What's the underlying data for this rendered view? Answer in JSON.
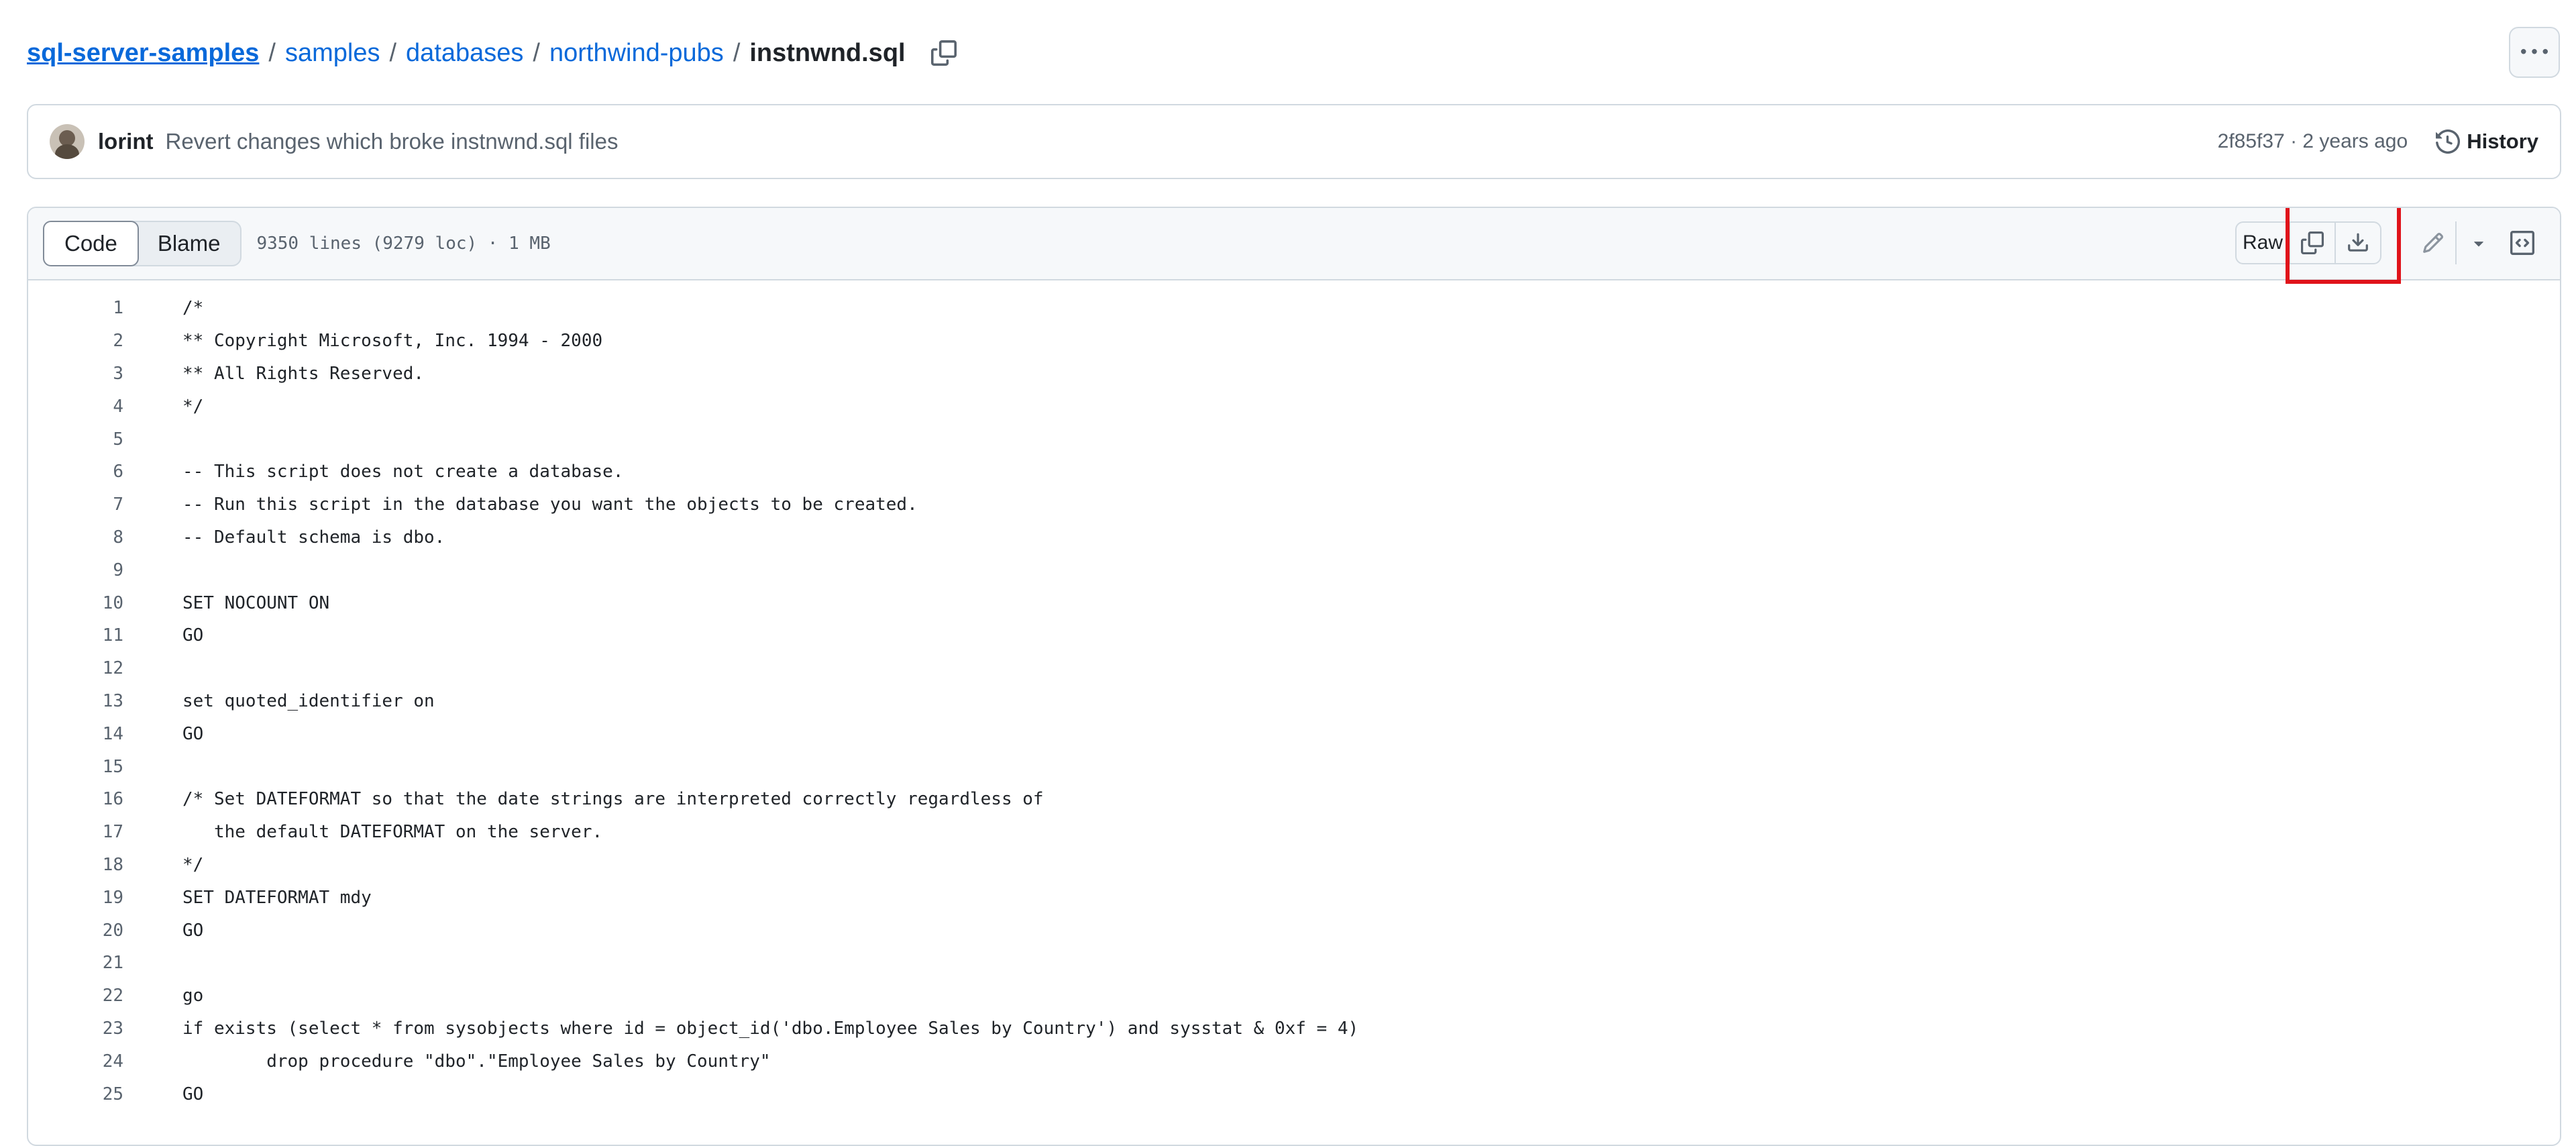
{
  "breadcrumb": {
    "repo": "sql-server-samples",
    "parts": [
      "samples",
      "databases",
      "northwind-pubs"
    ],
    "separator": "/",
    "file": "instnwnd.sql"
  },
  "commit": {
    "author": "lorint",
    "message": "Revert changes which broke instnwnd.sql files",
    "meta": "2f85f37 · 2 years ago",
    "history_label": "History"
  },
  "toolbar": {
    "code_tab": "Code",
    "blame_tab": "Blame",
    "file_info": "9350 lines (9279 loc) · 1 MB",
    "raw_label": "Raw"
  },
  "icons": {
    "copy": "copy-icon",
    "download": "download-icon",
    "edit": "pencil-icon",
    "dropdown": "triangle-down-icon",
    "symbols": "code-square-icon",
    "more": "kebab-horizontal-icon",
    "history": "history-icon"
  },
  "colors": {
    "link": "#0969da",
    "highlight": "#e0131a",
    "muted": "#59636e"
  },
  "code_lines": [
    {
      "n": "1",
      "t": "/*"
    },
    {
      "n": "2",
      "t": "** Copyright Microsoft, Inc. 1994 - 2000"
    },
    {
      "n": "3",
      "t": "** All Rights Reserved."
    },
    {
      "n": "4",
      "t": "*/"
    },
    {
      "n": "5",
      "t": ""
    },
    {
      "n": "6",
      "t": "-- This script does not create a database."
    },
    {
      "n": "7",
      "t": "-- Run this script in the database you want the objects to be created."
    },
    {
      "n": "8",
      "t": "-- Default schema is dbo."
    },
    {
      "n": "9",
      "t": ""
    },
    {
      "n": "10",
      "t": "SET NOCOUNT ON"
    },
    {
      "n": "11",
      "t": "GO"
    },
    {
      "n": "12",
      "t": ""
    },
    {
      "n": "13",
      "t": "set quoted_identifier on"
    },
    {
      "n": "14",
      "t": "GO"
    },
    {
      "n": "15",
      "t": ""
    },
    {
      "n": "16",
      "t": "/* Set DATEFORMAT so that the date strings are interpreted correctly regardless of"
    },
    {
      "n": "17",
      "t": "   the default DATEFORMAT on the server."
    },
    {
      "n": "18",
      "t": "*/"
    },
    {
      "n": "19",
      "t": "SET DATEFORMAT mdy"
    },
    {
      "n": "20",
      "t": "GO"
    },
    {
      "n": "21",
      "t": ""
    },
    {
      "n": "22",
      "t": "go"
    },
    {
      "n": "23",
      "t": "if exists (select * from sysobjects where id = object_id('dbo.Employee Sales by Country') and sysstat & 0xf = 4)"
    },
    {
      "n": "24",
      "t": "        drop procedure \"dbo\".\"Employee Sales by Country\""
    },
    {
      "n": "25",
      "t": "GO"
    }
  ]
}
